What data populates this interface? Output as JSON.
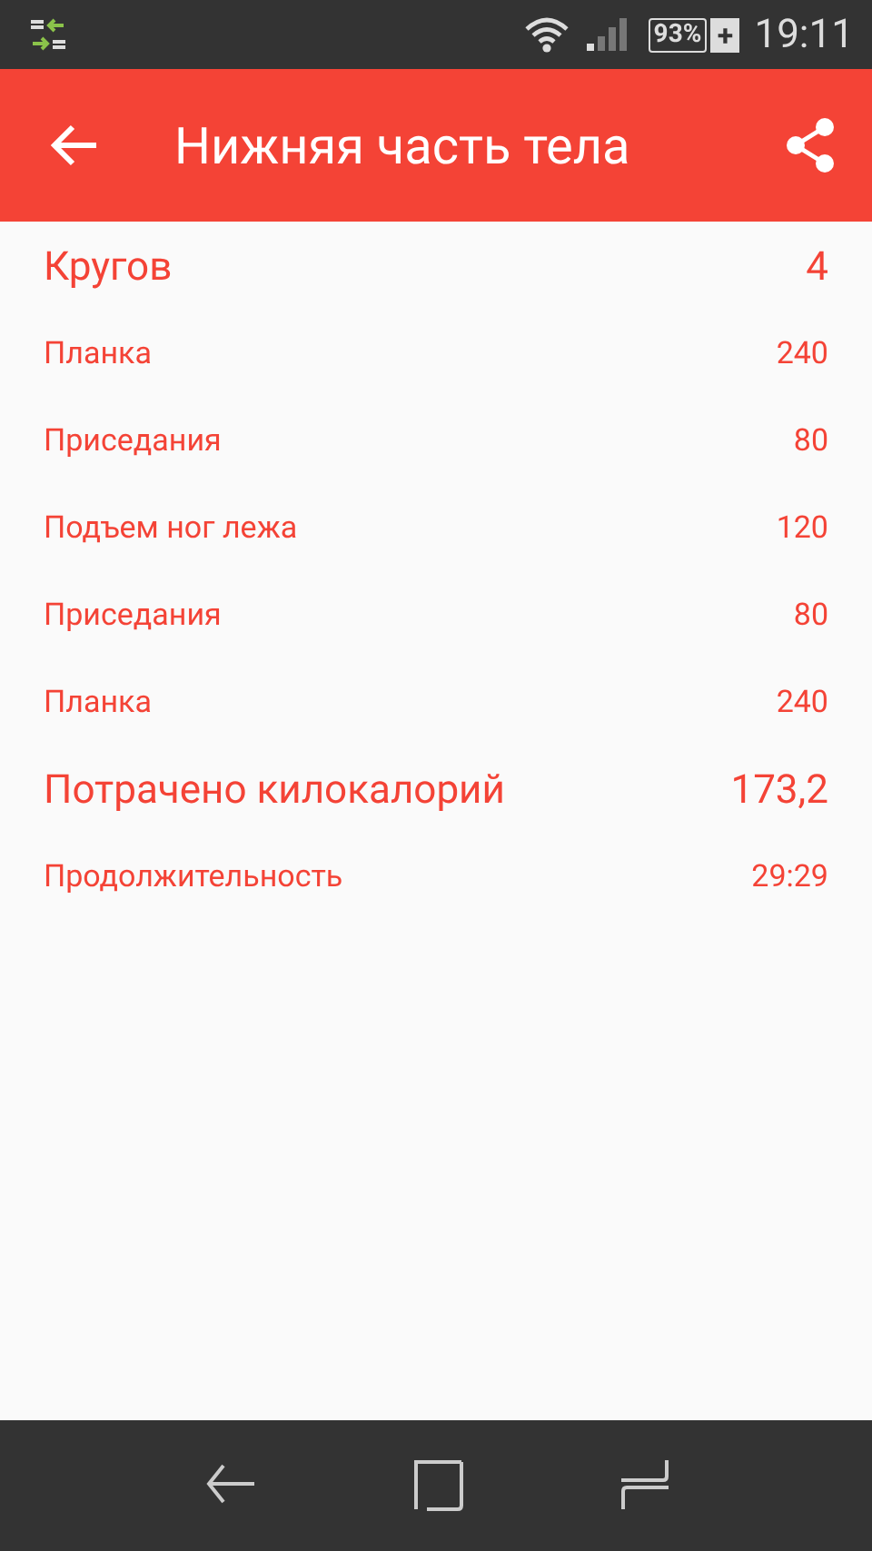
{
  "status_bar": {
    "battery": "93%",
    "battery_plus": "+",
    "time": "19:11"
  },
  "app_bar": {
    "title": "Нижняя часть тела"
  },
  "rows": [
    {
      "kind": "header",
      "label": "Кругов",
      "value": "4"
    },
    {
      "kind": "item",
      "label": "Планка",
      "value": "240"
    },
    {
      "kind": "item",
      "label": "Приседания",
      "value": "80"
    },
    {
      "kind": "item",
      "label": "Подъем ног лежа",
      "value": "120"
    },
    {
      "kind": "item",
      "label": "Приседания",
      "value": "80"
    },
    {
      "kind": "item",
      "label": "Планка",
      "value": "240"
    },
    {
      "kind": "header",
      "label": "Потрачено килокалорий",
      "value": "173,2"
    },
    {
      "kind": "item",
      "label": "Продолжительность",
      "value": "29:29"
    }
  ]
}
